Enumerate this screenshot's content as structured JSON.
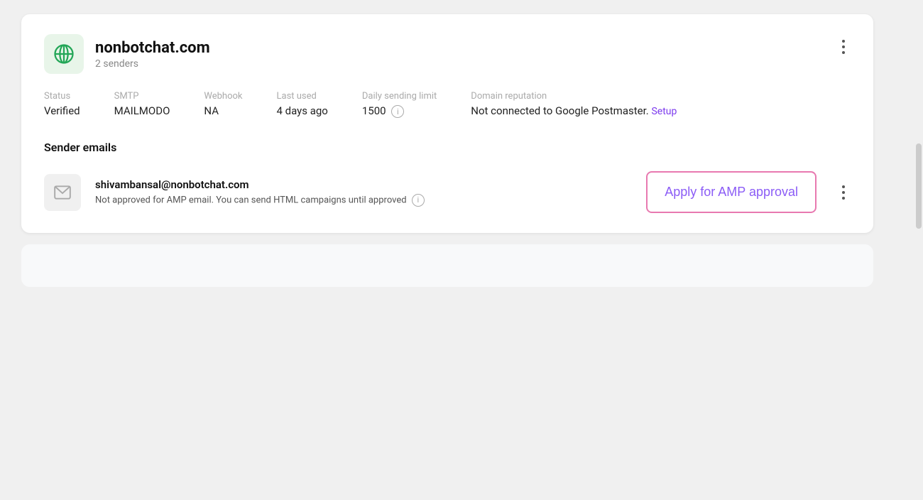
{
  "card": {
    "domain": {
      "name": "nonbotchat.com",
      "senders_count": "2 senders"
    },
    "meta": {
      "status_label": "Status",
      "status_value": "Verified",
      "smtp_label": "SMTP",
      "smtp_value": "MAILMODO",
      "webhook_label": "Webhook",
      "webhook_value": "NA",
      "last_used_label": "Last used",
      "last_used_value": "4 days ago",
      "daily_limit_label": "Daily sending limit",
      "daily_limit_value": "1500",
      "domain_rep_label": "Domain reputation",
      "domain_rep_value": "Not connected to Google Postmaster.",
      "setup_label": "Setup"
    },
    "sender_emails_section": {
      "title": "Sender emails"
    },
    "sender": {
      "email": "shivambansal@nonbotchat.com",
      "status_text": "Not approved for AMP email. You can send HTML campaigns until approved",
      "amp_button_label": "Apply for AMP approval"
    }
  }
}
